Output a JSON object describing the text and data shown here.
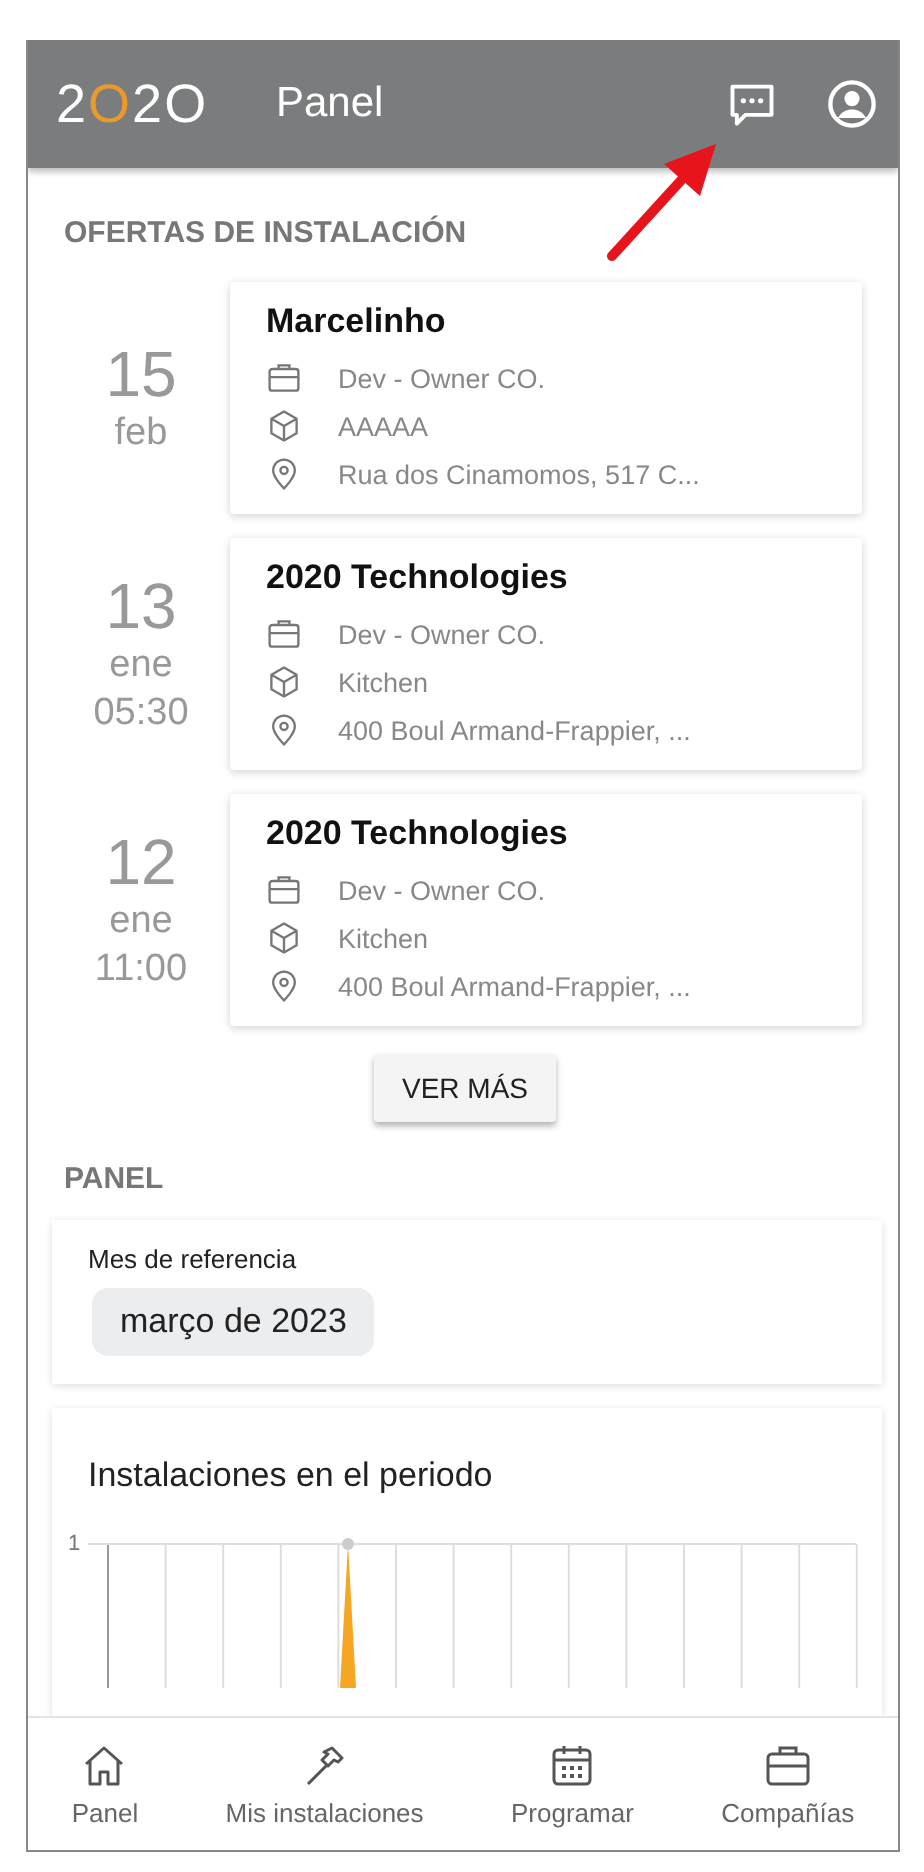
{
  "header": {
    "logo": "2O2O",
    "title": "Panel"
  },
  "offers_section": {
    "title": "OFERTAS DE INSTALACIÓN",
    "offers": [
      {
        "day": "15",
        "month": "feb",
        "name": "Marcelinho",
        "company": "Dev - Owner CO.",
        "product": "AAAAA",
        "address": "Rua dos Cinamomos, 517 C..."
      },
      {
        "day": "13",
        "month": "ene",
        "time": "05:30",
        "name": "2020 Technologies",
        "company": "Dev - Owner CO.",
        "product": "Kitchen",
        "address": "400 Boul Armand-Frappier, ..."
      },
      {
        "day": "12",
        "month": "ene",
        "time": "11:00",
        "name": "2020 Technologies",
        "company": "Dev - Owner CO.",
        "product": "Kitchen",
        "address": "400 Boul Armand-Frappier, ..."
      }
    ],
    "more_button": "VER MÁS"
  },
  "panel_section": {
    "title": "PANEL",
    "reference_label": "Mes de referencia",
    "reference_value": "março de 2023",
    "chart": {
      "title": "Instalaciones en el periodo",
      "y_tick": "1"
    }
  },
  "bottom_nav": [
    {
      "label": "Panel",
      "kind": "home"
    },
    {
      "label": "Mis instalaciones",
      "kind": "tools"
    },
    {
      "label": "Programar",
      "kind": "schedule"
    },
    {
      "label": "Compañías",
      "kind": "companies"
    }
  ]
}
